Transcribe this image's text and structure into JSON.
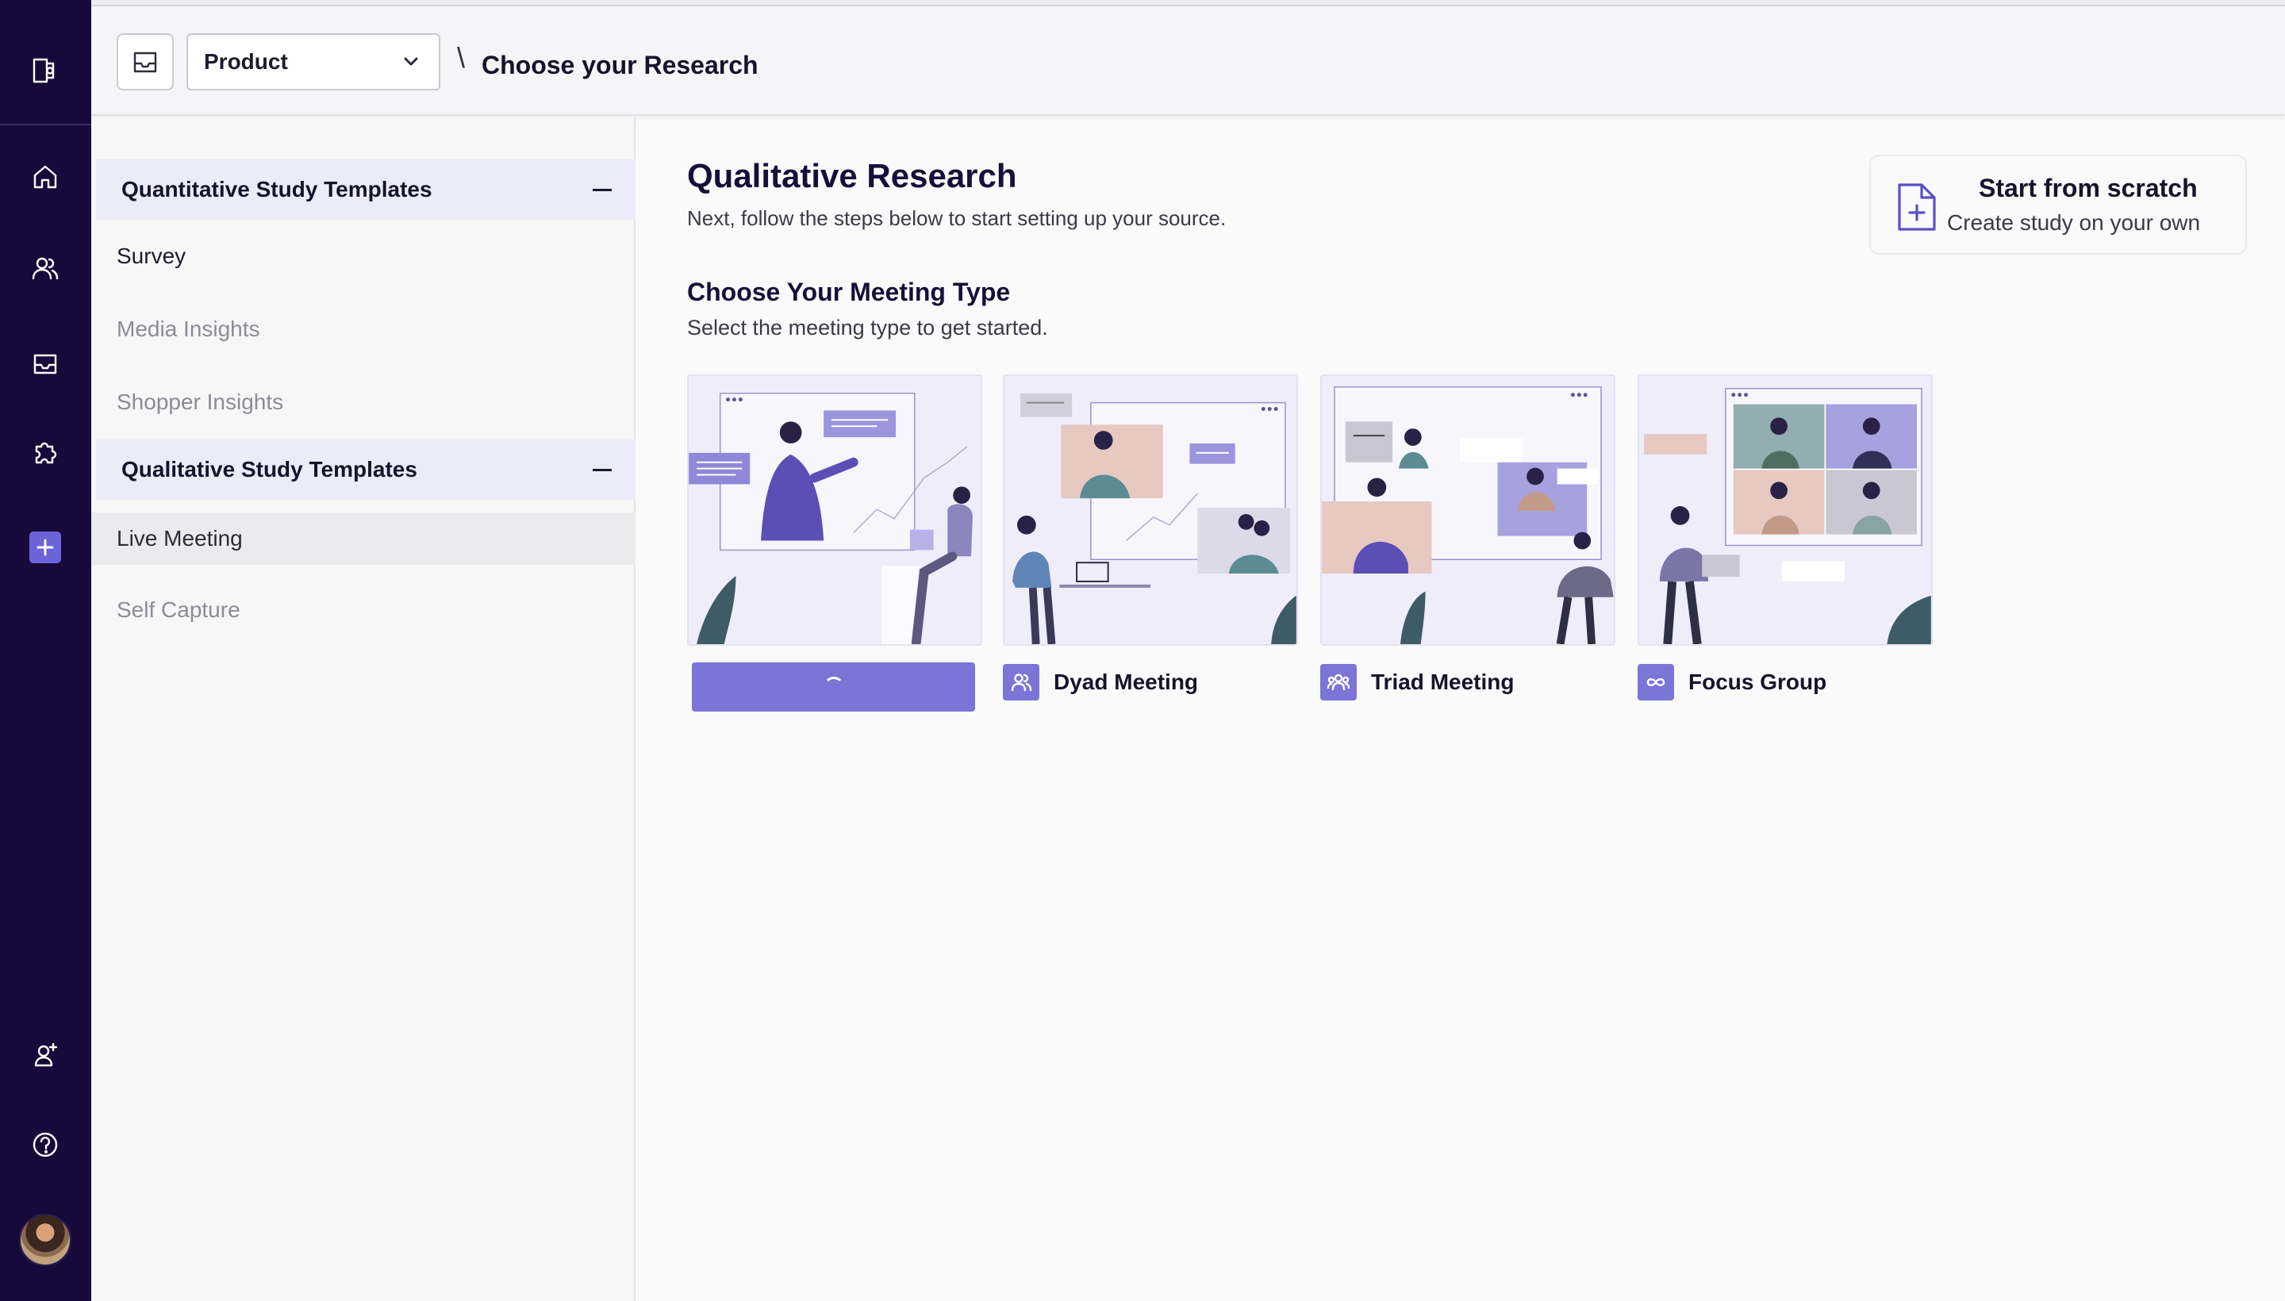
{
  "topbar": {
    "product_select": "Product",
    "breadcrumb_separator": "\\",
    "page_title": "Choose your Research"
  },
  "sidebar": {
    "groups": [
      {
        "title": "Quantitative Study Templates",
        "items": [
          "Survey",
          "Media Insights",
          "Shopper Insights"
        ]
      },
      {
        "title": "Qualitative Study Templates",
        "items": [
          "Live Meeting",
          "Self Capture"
        ]
      }
    ],
    "active_item": "Live Meeting"
  },
  "main": {
    "title": "Qualitative Research",
    "subtitle": "Next, follow the steps below to start setting up your source.",
    "section_title": "Choose Your Meeting Type",
    "section_subtitle": "Select the meeting type to get started.",
    "scratch": {
      "title": "Start from scratch",
      "subtitle": "Create study on your own"
    },
    "meeting_types": [
      {
        "label": "",
        "icon": "spinner-icon",
        "loading": true
      },
      {
        "label": "Dyad Meeting",
        "icon": "users-pair-icon"
      },
      {
        "label": "Triad Meeting",
        "icon": "users-group-icon"
      },
      {
        "label": "Focus Group",
        "icon": "infinity-icon"
      }
    ]
  },
  "colors": {
    "rail": "#170a3b",
    "accent": "#7b75d8",
    "accent_dark": "#5b4fc7",
    "group_header": "#ecebf8"
  }
}
